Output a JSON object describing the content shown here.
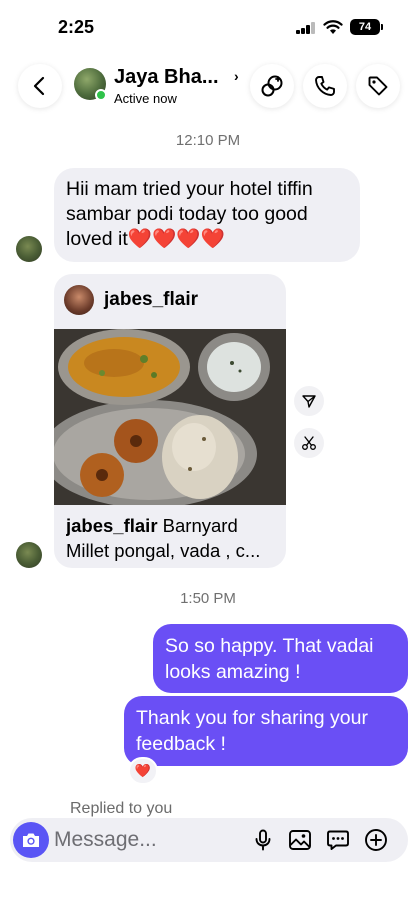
{
  "status_bar": {
    "time": "2:25",
    "battery": "74"
  },
  "header": {
    "contact_name": "Jaya Bha...",
    "chevron": "›",
    "status": "Active now"
  },
  "conversation": {
    "timestamp_1": "12:10 PM",
    "incoming_message": "Hii mam tried your hotel tiffin sambar podi today too good loved it❤️❤️❤️❤️",
    "shared_post": {
      "username": "jabes_flair",
      "caption_user": "jabes_flair",
      "caption_text_1": " Barnyard",
      "caption_text_2": "Millet pongal, vada , c..."
    },
    "timestamp_2": "1:50 PM",
    "outgoing_1": "So so happy. That vadai looks amazing !",
    "outgoing_2": "Thank you for sharing your feedback !",
    "reaction": "❤️",
    "replied_label": "Replied to you"
  },
  "composer": {
    "placeholder": "Message..."
  },
  "colors": {
    "outgoing_bubble": "#6a4ff5",
    "incoming_bubble": "#efeff4",
    "camera_button": "#5a55f5",
    "online_dot": "#2fc24a"
  },
  "icons": [
    "back-icon",
    "video-effects-icon",
    "phone-icon",
    "tag-icon",
    "send-post-icon",
    "cut-icon",
    "camera-icon",
    "microphone-icon",
    "gallery-icon",
    "sticker-icon",
    "plus-icon"
  ]
}
